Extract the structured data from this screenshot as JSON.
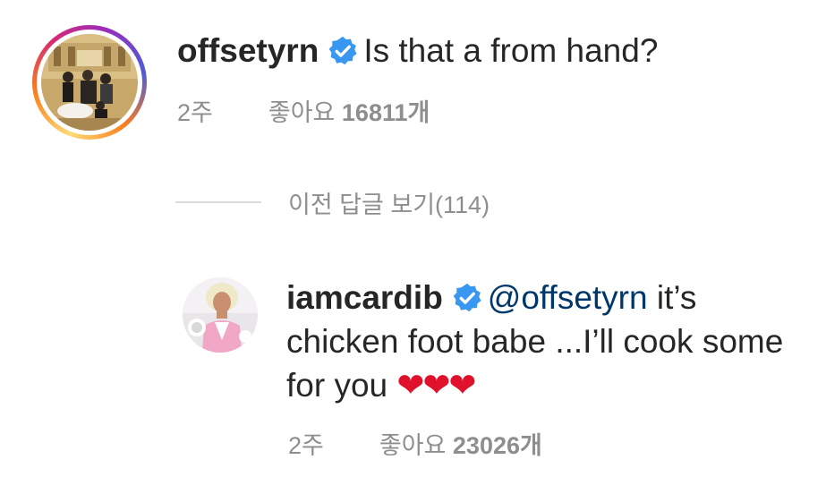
{
  "comment": {
    "username": "offsetyrn",
    "verified": true,
    "text": "Is that a from hand?",
    "time": "2주",
    "likes_label": "좋아요",
    "likes_count": "16811개"
  },
  "view_replies": {
    "label": "이전 답글 보기(114)"
  },
  "reply": {
    "username": "iamcardib",
    "verified": true,
    "mention": "@offsetyrn",
    "text": "it’s chicken foot babe ...I’ll cook some for you",
    "hearts": "❤❤❤",
    "time": "2주",
    "likes_label": "좋아요",
    "likes_count": "23026개"
  },
  "colors": {
    "verified_badge": "#3897f0",
    "mention": "#00376b",
    "meta_text": "#8e8e8e",
    "heart": "#e0112b"
  }
}
